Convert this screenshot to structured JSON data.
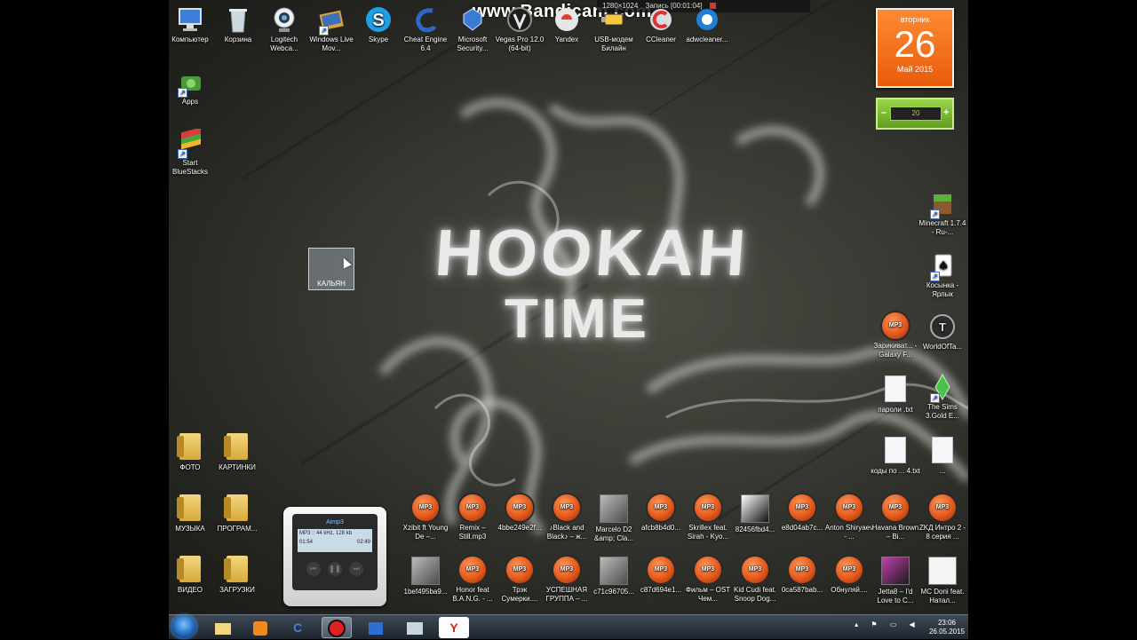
{
  "watermark": {
    "brand": "www.Bandicam.com",
    "resolution": "1280×1024",
    "recording": "Запись [00:01:04]"
  },
  "wallpaper": {
    "line1": "HOOKAH",
    "line2": "TIME"
  },
  "calendar": {
    "weekday": "вторник",
    "day": "26",
    "month": "Май 2015"
  },
  "gadget": {
    "value": "20",
    "minus": "–",
    "plus": "+"
  },
  "selected_icon": {
    "label": "КАЛЬЯН"
  },
  "top_icons": [
    {
      "label": "Компьютер"
    },
    {
      "label": "Корзина"
    },
    {
      "label": "Logitech Webca..."
    },
    {
      "label": "Windows Live Mov..."
    },
    {
      "label": "Skype"
    },
    {
      "label": "Cheat Engine 6.4"
    },
    {
      "label": "Microsoft Security..."
    },
    {
      "label": "Vegas Pro 12.0 (64-bit)"
    },
    {
      "label": "Yandex"
    },
    {
      "label": "USB-модем Билайн"
    },
    {
      "label": "CCleaner"
    },
    {
      "label": "adwcleaner..."
    }
  ],
  "left_icons": [
    {
      "label": "Apps"
    },
    {
      "label": "Start BlueStacks"
    },
    {
      "label": "ФОТО"
    },
    {
      "label": "КАРТИНКИ"
    },
    {
      "label": "МУЗЫКА"
    },
    {
      "label": "ПРОГРАМ..."
    },
    {
      "label": "ВИДЕО"
    },
    {
      "label": "ЗАГРУЗКИ"
    }
  ],
  "right_icons": [
    {
      "label": "Minecraft 1.7.4 - Ru-..."
    },
    {
      "label": "Косынка - Ярлык"
    },
    {
      "label": "Зарикиват... - Galaxy F..."
    },
    {
      "label": "WorldOfTa..."
    },
    {
      "label": "пароли .txt"
    },
    {
      "label": "The Sims 3.Gold E..."
    },
    {
      "label": "коды по ... 4.txt"
    },
    {
      "label": "..."
    }
  ],
  "mp3_badge": "MP3",
  "row1_icons": [
    {
      "label": "Xzibit ft Young De –..."
    },
    {
      "label": "Remix – Still.mp3"
    },
    {
      "label": "4bbe249e2f..."
    },
    {
      "label": "♪Black and Black♪ – ж..."
    },
    {
      "label": "Marcelo D2 &amp; Cla..."
    },
    {
      "label": "afcb8b4d0..."
    },
    {
      "label": "Skrillex feat. Sirah - Kyo..."
    },
    {
      "label": "82456fbd4..."
    },
    {
      "label": "e8d04ab7c..."
    },
    {
      "label": "Anton Shiryaev - ..."
    },
    {
      "label": "Havana Brown – Bi..."
    },
    {
      "label": "ZKД Интро 2 - 8 серия ..."
    }
  ],
  "row2_icons": [
    {
      "label": "1bef495ba9..."
    },
    {
      "label": "Honor feat B.A.N.G. - ..."
    },
    {
      "label": "Трэк Сумерки...."
    },
    {
      "label": "УСПЕШНАЯ ГРУППА – ..."
    },
    {
      "label": "c71c96705..."
    },
    {
      "label": "c87d694e1..."
    },
    {
      "label": "Фильм – OST Чем..."
    },
    {
      "label": "Kid Cudi feat. Snoop Dog..."
    },
    {
      "label": "0ca587bab..."
    },
    {
      "label": "Обнуляй...."
    },
    {
      "label": "Jetta8 – I'd Love to C..."
    },
    {
      "label": "MC Doni feat. Натал..."
    }
  ],
  "aimp": {
    "name": "Aimp3",
    "info": "MP3 :: 44 kHz, 128 kb",
    "time_left": "01:54",
    "time_right": "02:49"
  },
  "taskbar": {
    "time": "23:06",
    "date": "26.05.2015"
  }
}
